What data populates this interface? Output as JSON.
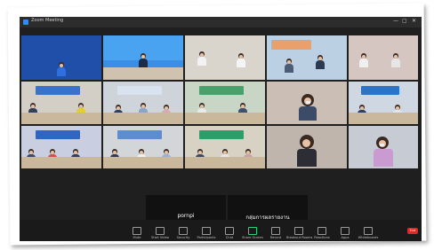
{
  "window": {
    "title": "Zoom Meeting",
    "controls": [
      "—",
      "▢",
      "✕"
    ]
  },
  "tiles": [
    {
      "id": "t1",
      "kind": "slide",
      "lines": [
        "",
        ""
      ],
      "name": ""
    },
    {
      "id": "t2",
      "kind": "room",
      "name": ""
    },
    {
      "id": "t3",
      "kind": "person",
      "name": ""
    },
    {
      "id": "t4",
      "kind": "person",
      "name": ""
    },
    {
      "id": "t5",
      "kind": "room",
      "name": ""
    },
    {
      "id": "t6",
      "kind": "person",
      "name": ""
    },
    {
      "id": "t7",
      "kind": "room",
      "name": ""
    },
    {
      "id": "t8",
      "kind": "room",
      "name": ""
    },
    {
      "id": "t9",
      "kind": "room",
      "name": ""
    },
    {
      "id": "t10",
      "kind": "person",
      "name": ""
    },
    {
      "id": "t11",
      "kind": "room",
      "name": ""
    },
    {
      "id": "t12",
      "kind": "room",
      "name": ""
    },
    {
      "id": "t13",
      "kind": "room",
      "name": ""
    },
    {
      "id": "t14",
      "kind": "room",
      "name": ""
    },
    {
      "id": "t15",
      "kind": "person",
      "name": ""
    },
    {
      "id": "t16",
      "kind": "person",
      "name": ""
    }
  ],
  "blank_tiles": [
    {
      "display_name": "pornpi",
      "label": ""
    },
    {
      "display_name": "กลุ่มการผลรายงาน",
      "label": ""
    }
  ],
  "toolbar": {
    "buttons": [
      {
        "label": "Mute",
        "icon": "microphone-icon"
      },
      {
        "label": "Start Video",
        "icon": "video-camera-icon"
      },
      {
        "label": "Security",
        "icon": "shield-icon"
      },
      {
        "label": "Participants",
        "icon": "participants-icon"
      },
      {
        "label": "Chat",
        "icon": "chat-icon"
      },
      {
        "label": "Share Screen",
        "icon": "share-screen-icon"
      },
      {
        "label": "Record",
        "icon": "record-icon"
      },
      {
        "label": "Breakout Rooms",
        "icon": "breakout-rooms-icon"
      },
      {
        "label": "Reactions",
        "icon": "reactions-icon"
      },
      {
        "label": "Apps",
        "icon": "apps-icon"
      },
      {
        "label": "Whiteboards",
        "icon": "whiteboard-icon"
      }
    ],
    "end_label": "End"
  },
  "colors": {
    "window_bg": "#1f1f1f",
    "toolbar_bg": "#1a1a1a",
    "end_red": "#e02828",
    "share_green": "#2fd27a"
  }
}
